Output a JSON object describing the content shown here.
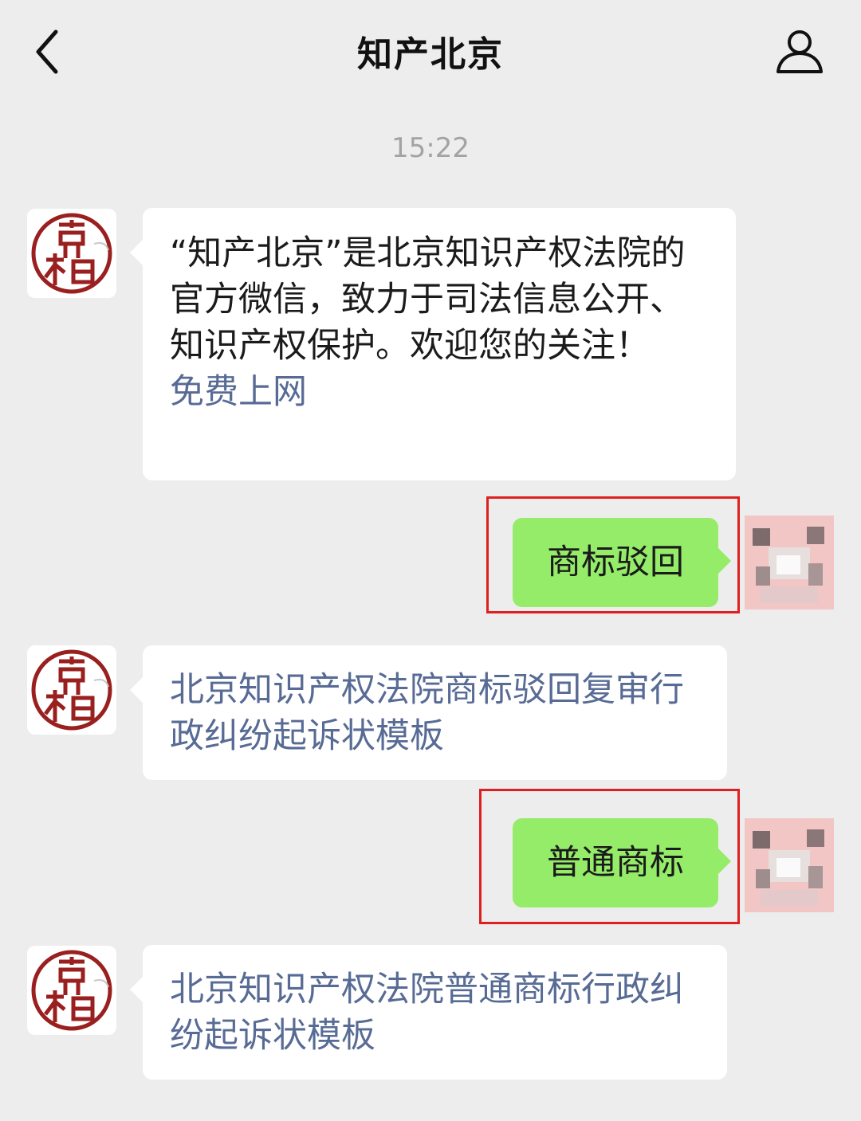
{
  "header": {
    "title": "知产北京"
  },
  "timestamp": "15:22",
  "messages": [
    {
      "from": "official",
      "text": "“知产北京”是北京知识产权法院的官方微信，致力于司法信息公开、知识产权保护。欢迎您的关注！",
      "link": "免费上网"
    },
    {
      "from": "user",
      "text": "商标驳回"
    },
    {
      "from": "official",
      "link": "北京知识产权法院商标驳回复审行政纠纷起诉状模板"
    },
    {
      "from": "user",
      "text": "普通商标"
    },
    {
      "from": "official",
      "link": "北京知识产权法院普通商标行政纠纷起诉状模板"
    }
  ],
  "icons": {
    "back": "chevron-left-icon",
    "profile": "person-icon"
  },
  "colors": {
    "background": "#ededed",
    "sent_bubble": "#95ec69",
    "link": "#576b95",
    "highlight": "#e02020"
  }
}
